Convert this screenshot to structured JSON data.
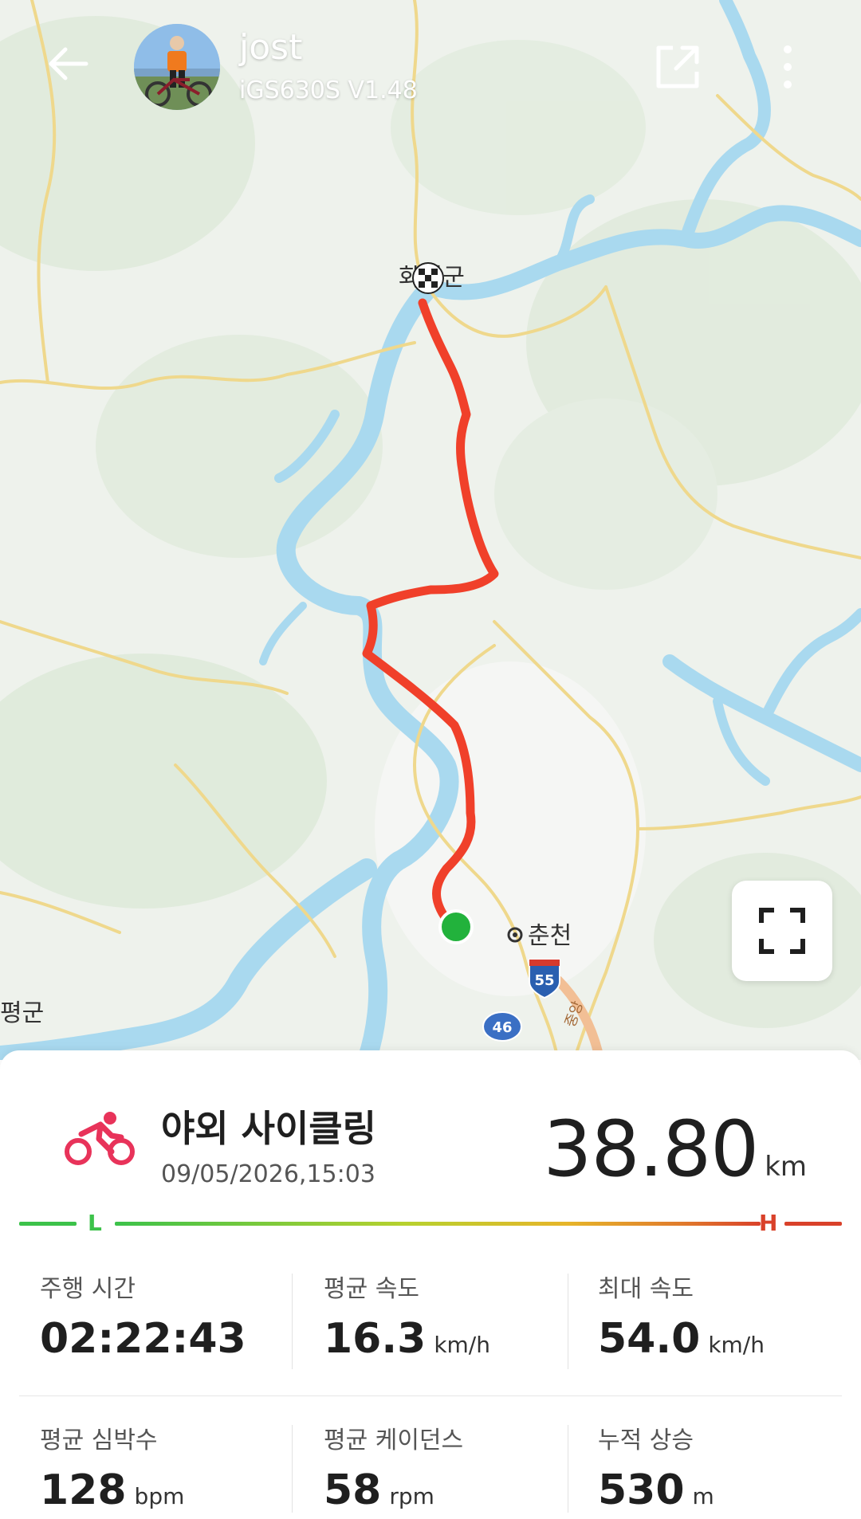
{
  "header": {
    "user_name": "jost",
    "device": "iGS630S  V1.48"
  },
  "map": {
    "labels": {
      "hwacheon": "화천군",
      "chuncheon": "춘천",
      "gapyeong": "평군",
      "expressway": "55",
      "road_46": "46",
      "expressway_name": "중앙"
    }
  },
  "activity": {
    "title": "야외 사이클링",
    "datetime": "09/05/2026,15:03",
    "distance": "38.80",
    "distance_unit": "km"
  },
  "intensity": {
    "low": "L",
    "high": "H"
  },
  "stats": [
    {
      "label": "주행 시간",
      "value": "02:22:43",
      "unit": ""
    },
    {
      "label": "평균 속도",
      "value": "16.3",
      "unit": "km/h"
    },
    {
      "label": "최대 속도",
      "value": "54.0",
      "unit": "km/h"
    },
    {
      "label": "평균 심박수",
      "value": "128",
      "unit": "bpm"
    },
    {
      "label": "평균 케이던스",
      "value": "58",
      "unit": "rpm"
    },
    {
      "label": "누적 상승",
      "value": "530",
      "unit": "m"
    }
  ],
  "colors": {
    "route": "#f0402a",
    "start": "#22b23c",
    "water": "#a9d9ef",
    "land": "#eef2ec",
    "road": "#efd88c",
    "accent": "#e8335a"
  }
}
